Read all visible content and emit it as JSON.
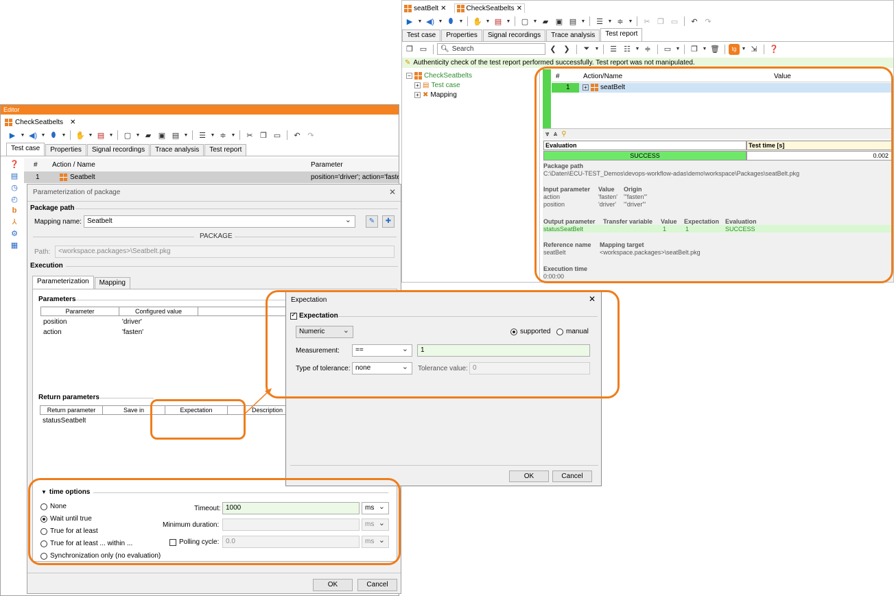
{
  "editor": {
    "title": "Editor",
    "doc_tab": "CheckSeatbelts",
    "tabs": [
      "Test case",
      "Properties",
      "Signal recordings",
      "Trace analysis",
      "Test report"
    ],
    "grid_headers": {
      "num": "#",
      "action": "Action / Name",
      "param": "Parameter"
    },
    "row": {
      "num": "1",
      "name": "Seatbelt",
      "param": "position='driver'; action='fasten'"
    }
  },
  "param_dialog": {
    "title": "Parameterization of package",
    "package_path_label": "Package path",
    "mapping_name_label": "Mapping name:",
    "mapping_name_value": "Seatbelt",
    "package_divider": "PACKAGE",
    "path_label": "Path:",
    "path_value": "<workspace.packages>\\Seatbelt.pkg",
    "execution_label": "Execution",
    "tabs": [
      "Parameterization",
      "Mapping"
    ],
    "parameters_label": "Parameters",
    "param_headers": [
      "Parameter",
      "Configured value",
      "Description"
    ],
    "param_rows": [
      {
        "name": "position",
        "value": "'driver'"
      },
      {
        "name": "action",
        "value": "'fasten'"
      }
    ],
    "return_label": "Return parameters",
    "return_headers": [
      "Return parameter",
      "Save in",
      "Expectation",
      "Description"
    ],
    "return_rows": [
      {
        "name": "statusSeatbelt"
      }
    ],
    "time_options": {
      "label": "time options",
      "radios": [
        {
          "label": "None",
          "checked": false
        },
        {
          "label": "Wait until true",
          "checked": true
        },
        {
          "label": "True for at least",
          "checked": false
        },
        {
          "label": "True for at least ... within ...",
          "checked": false
        },
        {
          "label": "Synchronization only (no evaluation)",
          "checked": false
        }
      ],
      "timeout_label": "Timeout:",
      "timeout_value": "1000",
      "timeout_unit": "ms",
      "min_duration_label": "Minimum duration:",
      "min_duration_unit": "ms",
      "polling_label": "Polling cycle:",
      "polling_value": "0.0",
      "polling_unit": "ms"
    },
    "ok": "OK",
    "cancel": "Cancel"
  },
  "expectation_dialog": {
    "title": "Expectation",
    "checkbox_label": "Expectation",
    "type_value": "Numeric",
    "supported_label": "supported",
    "manual_label": "manual",
    "measurement_label": "Measurement:",
    "measurement_op": "==",
    "measurement_value": "1",
    "tolerance_type_label": "Type of tolerance:",
    "tolerance_type_value": "none",
    "tolerance_value_label": "Tolerance value:",
    "tolerance_value": "0",
    "ok": "OK",
    "cancel": "Cancel"
  },
  "report": {
    "doc_tabs": [
      "seatBelt",
      "CheckSeatbelts"
    ],
    "tabs": [
      "Test case",
      "Properties",
      "Signal recordings",
      "Trace analysis",
      "Test report"
    ],
    "search_placeholder": "Search",
    "auth_message": "Authenticity check of the test report performed successfully. Test report was not manipulated.",
    "tree": {
      "root": "CheckSeatbelts",
      "child1": "Test case",
      "child2": "Mapping"
    },
    "grid_headers": {
      "num": "#",
      "action": "Action/Name",
      "value": "Value"
    },
    "row": {
      "num": "1",
      "name": "seatBelt"
    },
    "eval_header": "Evaluation",
    "time_header": "Test time [s]",
    "eval_result": "SUCCESS",
    "test_time": "0.002",
    "package_path_label": "Package path",
    "package_path": "C:\\Daten\\ECU-TEST_Demos\\devops-workflow-adas\\demo\\workspace\\Packages\\seatBelt.pkg",
    "input_headers": [
      "Input parameter",
      "Value",
      "Origin"
    ],
    "input_rows": [
      [
        "action",
        "'fasten'",
        "'\"fasten\"'"
      ],
      [
        "position",
        "'driver'",
        "'\"driver\"'"
      ]
    ],
    "output_headers": [
      "Output parameter",
      "Transfer variable",
      "Value",
      "Expectation",
      "Evaluation"
    ],
    "output_row": [
      "statusSeatBelt",
      "",
      "1",
      "1",
      "SUCCESS"
    ],
    "ref_headers": [
      "Reference name",
      "Mapping target"
    ],
    "ref_row": [
      "seatBelt",
      "<workspace.packages>\\seatBelt.pkg"
    ],
    "exec_time_label": "Execution time",
    "exec_time_value": "0:00:00"
  },
  "colors": {
    "highlight": "#ee7d1c",
    "success": "#6fe86a",
    "editor_titlebar": "#f58220"
  }
}
